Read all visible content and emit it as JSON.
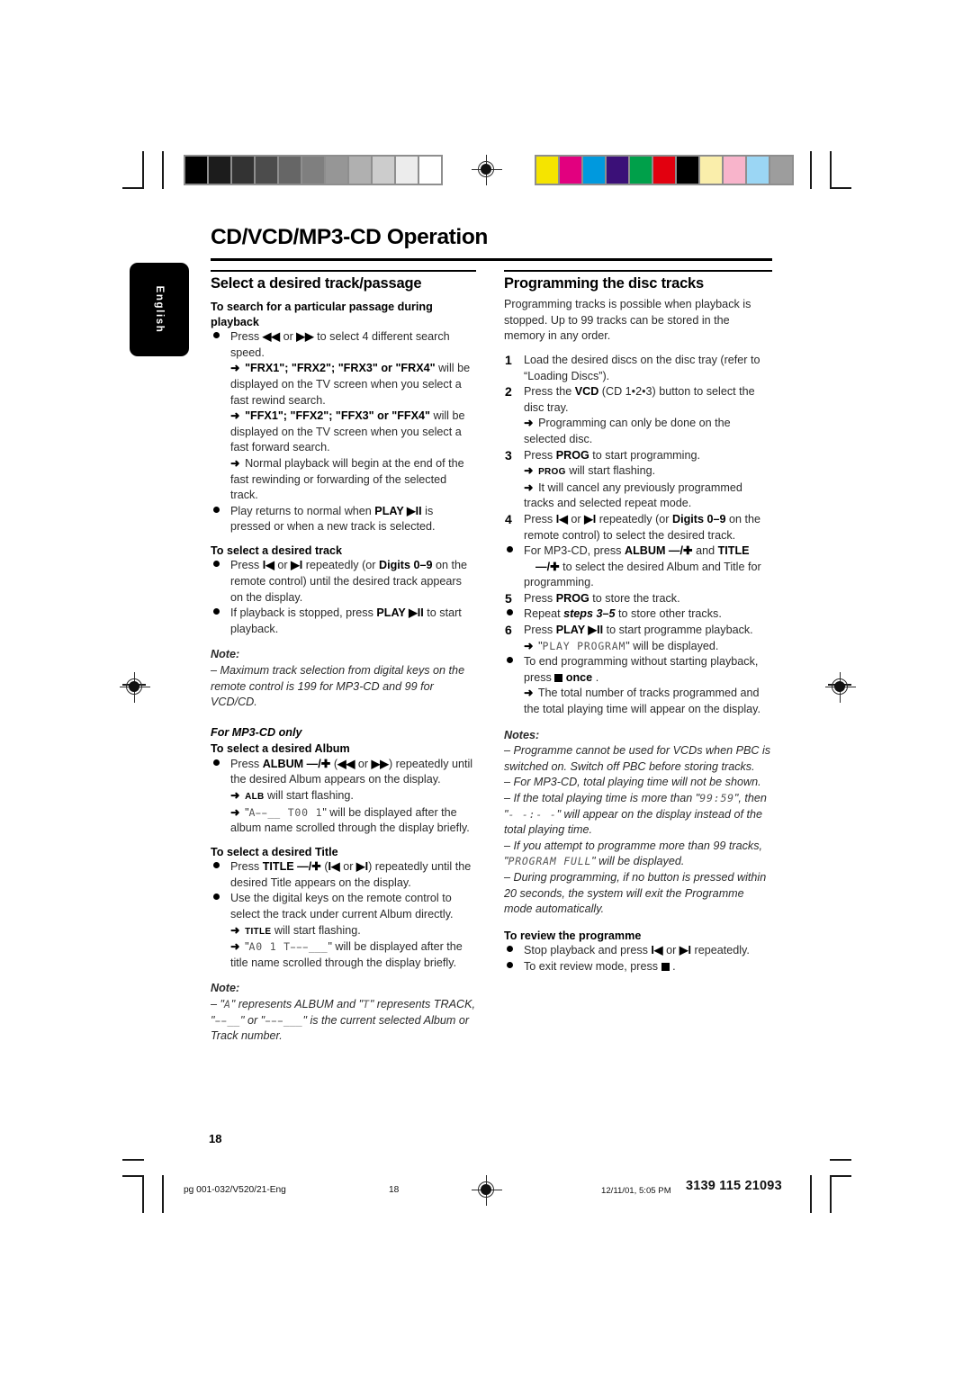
{
  "document": {
    "title": "CD/VCD/MP3-CD Operation",
    "language_tab": "English",
    "page_number": "18"
  },
  "printer_marks": {
    "grayscale_swatches": [
      "#000000",
      "#1c1c1c",
      "#333333",
      "#4c4c4c",
      "#666666",
      "#7f7f7f",
      "#969696",
      "#b0b0b0",
      "#cccccc",
      "#ececec",
      "#ffffff"
    ],
    "color_swatches": [
      "#f5e400",
      "#e2007f",
      "#0099de",
      "#3b1078",
      "#00a04a",
      "#e2000f",
      "#000000",
      "#faeeab",
      "#f8b4cb",
      "#9bd6f4",
      "#9d9d9d"
    ]
  },
  "left_column": {
    "section_title": "Select a desired track/passage",
    "sub1_title": "To search for a particular passage during playback",
    "b1_line1_pre": "Press ",
    "b1_rew": "◀◀",
    "b1_mid": " or ",
    "b1_ffw": "▶▶",
    "b1_line1_post": " to select 4 different search speed.",
    "b1_arrow1": "\"FRX1\"; \"FRX2\"; \"FRX3\" or \"FRX4\"",
    "b1_arrow1_rest": " will be displayed on the TV screen when you select a fast rewind search.",
    "b1_arrow2": "\"FFX1\"; \"FFX2\"; \"FFX3\" or \"FFX4\"",
    "b1_arrow2_rest": " will be displayed on the TV screen when you select a fast forward search.",
    "b1_arrow3": "Normal playback will begin at the end of the fast rewinding or forwarding of the selected track.",
    "b2_pre": "Play returns to normal when ",
    "b2_key": "PLAY ▶II",
    "b2_post": " is pressed or when a new track is selected.",
    "sub2_title": "To select a desired track",
    "b3_pre": "Press ",
    "b3_prev": "I◀",
    "b3_mid": " or ",
    "b3_next": "▶I",
    "b3_mid2": " repeatedly (or ",
    "b3_digits": "Digits 0–9",
    "b3_post": " on the remote control) until the desired track appears on the display.",
    "b4_pre": "If playback is stopped, press ",
    "b4_key": "PLAY ▶II",
    "b4_post": " to start playback.",
    "note1_head": "Note:",
    "note1_body": "–  Maximum track selection from digital keys on the remote control is 199 for MP3-CD and 99 for VCD/CD.",
    "mp3_only": "For MP3-CD only",
    "sub3_title": "To select a desired Album",
    "b5_pre": "Press ",
    "b5_key": "ALBUM —/✚",
    "b5_mid": " (",
    "b5_rew": "◀◀",
    "b5_or": " or ",
    "b5_ffw": "▶▶",
    "b5_post": ") repeatedly until the desired Album appears on the display.",
    "b5_arrow1_caps": "ALB",
    "b5_arrow1_rest": " will start flashing.",
    "b5_arrow2_pre": "\"",
    "b5_arrow2_lcd": "A̵̵̲̲ T00 1",
    "b5_arrow2_post": "\" will be displayed after the album name scrolled through the display briefly.",
    "sub4_title": "To select a desired Title",
    "b6_pre": "Press ",
    "b6_key": "TITLE —/✚",
    "b6_mid": " (",
    "b6_prev": "I◀",
    "b6_or": " or ",
    "b6_next": "▶I",
    "b6_post": ") repeatedly until the desired Title appears on the display.",
    "b7": "Use the digital keys on the remote control to select the track under current Album directly.",
    "b7_arrow1_caps": "TITLE",
    "b7_arrow1_rest": " will start flashing.",
    "b7_arrow2_pre": "\"",
    "b7_arrow2_lcd": "A0 1 T̵̵̵̲̲̲",
    "b7_arrow2_post": "\" will be displayed after the title name scrolled through the display briefly.",
    "note2_head": "Note:",
    "note2_a": "–  \"",
    "note2_lcd_a": "A",
    "note2_b": "\" represents ALBUM and \"",
    "note2_lcd_t": "T",
    "note2_c": "\" represents TRACK, \"",
    "note2_lcd_xx": "̵̵̲̲",
    "note2_d": "\" or \"",
    "note2_lcd_xxx": "̵̵̵̲̲̲",
    "note2_e": "\" is the current selected Album or Track number."
  },
  "right_column": {
    "section_title": "Programming the disc tracks",
    "intro": "Programming tracks is possible when playback is stopped. Up to 99 tracks can be stored in the memory in any order.",
    "step1_num": "1",
    "step1": "Load the desired discs on the disc tray (refer to “Loading Discs”).",
    "step2_num": "2",
    "step2_pre": "Press the ",
    "step2_key": "VCD",
    "step2_post": " (CD 1•2•3) button to select the disc tray.",
    "step2_arrow": "Programming can only be done on the selected disc.",
    "step3_num": "3",
    "step3_pre": "Press ",
    "step3_key": "PROG",
    "step3_post": " to start programming.",
    "step3_arrow1_caps": "PROG",
    "step3_arrow1_rest": " will start flashing.",
    "step3_arrow2": "It will cancel any previously programmed tracks and selected repeat mode.",
    "step4_num": "4",
    "step4_pre": "Press ",
    "step4_prev": "I◀",
    "step4_mid": " or ",
    "step4_next": "▶I",
    "step4_mid2": " repeatedly (or ",
    "step4_digits": "Digits 0–9",
    "step4_post": " on the remote control) to select the desired track.",
    "b_mp3_pre": "For MP3-CD, press ",
    "b_mp3_k1": "ALBUM —/✚",
    "b_mp3_and": " and ",
    "b_mp3_k2": "TITLE",
    "b_mp3_k3": "—/✚",
    "b_mp3_post": " to select the desired Album and Title for programming.",
    "step5_num": "5",
    "step5_pre": "Press ",
    "step5_key": "PROG",
    "step5_post": " to store the track.",
    "b_repeat_pre": "Repeat ",
    "b_repeat_em": "steps 3–5",
    "b_repeat_post": " to store other tracks.",
    "step6_num": "6",
    "step6_pre": "Press ",
    "step6_key": "PLAY ▶II",
    "step6_post": " to start programme playback.",
    "step6_arrow_pre": "\"",
    "step6_arrow_lcd": "PLAY PROGRAM",
    "step6_arrow_post": "\" will be displayed.",
    "b_end_pre": "To end programming without starting playback, press ",
    "b_end_key": "once",
    "b_end_post": " .",
    "b_end_arrow": "The total number of tracks programmed and the total playing time will appear on the display.",
    "notes_head": "Notes:",
    "note_a": "–  Programme cannot be used for VCDs when PBC is switched on. Switch off PBC before storing tracks.",
    "note_b": "–  For MP3-CD, total playing time will not be shown.",
    "note_c_pre": "–  If the total playing time is more than \"",
    "note_c_lcd1": "99:59",
    "note_c_mid": "\", then \"",
    "note_c_lcd2": "- -:- -",
    "note_c_post": "\" will appear on the display instead of the total playing time.",
    "note_d_pre": "–  If you attempt to programme more than 99 tracks, \"",
    "note_d_lcd": "PROGRAM FULL",
    "note_d_post": "\" will be displayed.",
    "note_e": "–  During programming, if no button is pressed within 20 seconds, the system will exit the Programme mode automatically.",
    "review_title": "To review the programme",
    "b_rev1_pre": "Stop playback and press ",
    "b_rev1_prev": "I◀",
    "b_rev1_mid": " or ",
    "b_rev1_next": "▶I",
    "b_rev1_post": " repeatedly.",
    "b_rev2_pre": "To exit review mode, press ",
    "b_rev2_post": " ."
  },
  "footer": {
    "file": "pg 001-032/V520/21-Eng",
    "page": "18",
    "date": "12/11/01, 5:05 PM",
    "code": "3139 115 21093"
  }
}
